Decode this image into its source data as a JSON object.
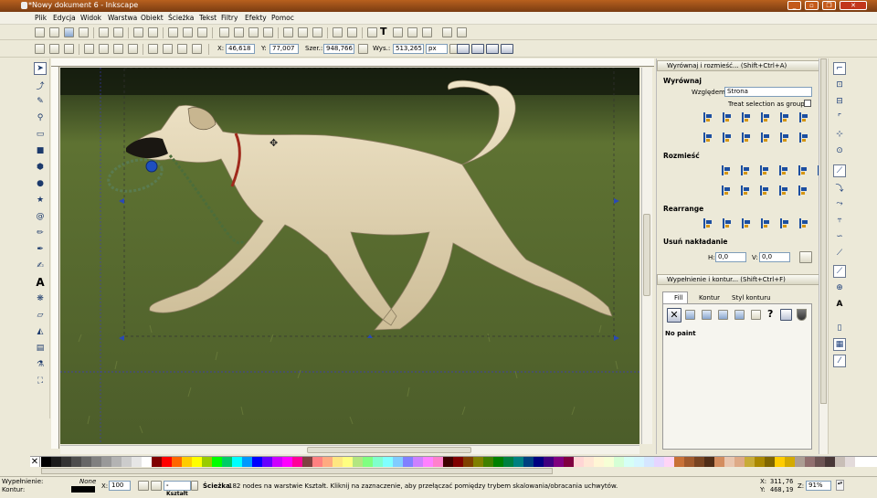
{
  "window": {
    "title": "*Nowy dokument 6 - Inkscape"
  },
  "menu": [
    "Plik",
    "Edycja",
    "Widok",
    "Warstwa",
    "Obiekt",
    "Ścieżka",
    "Tekst",
    "Filtry",
    "Efekty",
    "Pomoc"
  ],
  "controls": {
    "x_label": "X:",
    "x_value": "46,618",
    "y_label": "Y:",
    "y_value": "77,007",
    "w_label": "Szer.:",
    "w_value": "948,766",
    "h_label": "Wys.:",
    "h_value": "513,265",
    "unit": "px"
  },
  "align_panel": {
    "title": "Wyrównaj i rozmieść... (Shift+Ctrl+A)",
    "section_align": "Wyrównaj",
    "relative_label": "Względem:",
    "relative_value": "Strona",
    "treat_group": "Treat selection as group:",
    "section_distribute": "Rozmieść",
    "section_rearrange": "Rearrange",
    "section_overlap": "Usuń nakładanie",
    "h_label": "H:",
    "h_value": "0,0",
    "v_label": "V:",
    "v_value": "0,0"
  },
  "fill_panel": {
    "title": "Wypełnienie i kontur... (Shift+Ctrl+F)",
    "tabs": [
      "Fill",
      "Kontur",
      "Styl konturu"
    ],
    "paint_status": "No paint"
  },
  "status": {
    "fill_label": "Wypełnienie:",
    "fill_value": "None",
    "stroke_label": "Kontur:",
    "opacity_label": "X:",
    "opacity_value": "100",
    "layer": "-Kształt",
    "message_bold": "Ścieżka",
    "message": "182 nodes na warstwie Kształt. Kliknij na zaznaczenie, aby przełączać pomiędzy trybem skalowania/obracania uchwytów.",
    "x_label": "X:",
    "x_value": "311,76",
    "y_label": "Y:",
    "y_value": "468,19",
    "zoom_label": "Z:",
    "zoom_value": "91%"
  },
  "colors": {
    "titlebar": "#9a4c18",
    "accent": "#1c4fa1",
    "dog": "#dccfae"
  },
  "palette": [
    "#000000",
    "#1a1a1a",
    "#333333",
    "#4d4d4d",
    "#666666",
    "#808080",
    "#999999",
    "#b3b3b3",
    "#cccccc",
    "#e6e6e6",
    "#ffffff",
    "#800000",
    "#ff0000",
    "#ff6600",
    "#ffcc00",
    "#ffff00",
    "#99cc00",
    "#00ff00",
    "#00cc66",
    "#00ffff",
    "#0099ff",
    "#0000ff",
    "#6600ff",
    "#cc00ff",
    "#ff00ff",
    "#ff0099",
    "#804040",
    "#ff8080",
    "#ffaa80",
    "#ffe680",
    "#ffff80",
    "#b3e680",
    "#80ff80",
    "#80ffcc",
    "#80ffff",
    "#80ccff",
    "#8080ff",
    "#cc80ff",
    "#ff80ff",
    "#ff80cc",
    "#400000",
    "#800000",
    "#804000",
    "#808000",
    "#408000",
    "#008000",
    "#008040",
    "#008080",
    "#004080",
    "#000080",
    "#400080",
    "#800080",
    "#800040",
    "#ffd5d5",
    "#ffe6d5",
    "#fff6d5",
    "#f6ffd5",
    "#d5ffd5",
    "#d5fff6",
    "#d5f6ff",
    "#d5e6ff",
    "#e6d5ff",
    "#ffd5f6",
    "#c87137",
    "#a05a2c",
    "#784421",
    "#502d16",
    "#d38d5f",
    "#e9c6af",
    "#deaa87",
    "#c8ab37",
    "#aa8800",
    "#806600",
    "#ffcc00",
    "#d4aa00",
    "#ac9d93",
    "#916f6f",
    "#6c5353",
    "#483737",
    "#c8beb7",
    "#e3dbdb"
  ]
}
